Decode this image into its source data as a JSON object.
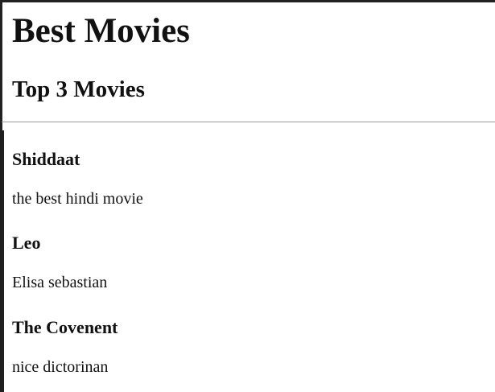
{
  "page": {
    "title": "Best Movies",
    "subtitle": "Top 3 Movies"
  },
  "movies": [
    {
      "name": "Shiddaat",
      "description": "the best hindi movie"
    },
    {
      "name": "Leo",
      "description": "Elisa sebastian"
    },
    {
      "name": "The Covenent",
      "description": "nice dictorinan"
    }
  ],
  "colors": {
    "text": "#111111",
    "background": "#ffffff",
    "divider": "#9a9a9a",
    "frame": "#222222"
  }
}
